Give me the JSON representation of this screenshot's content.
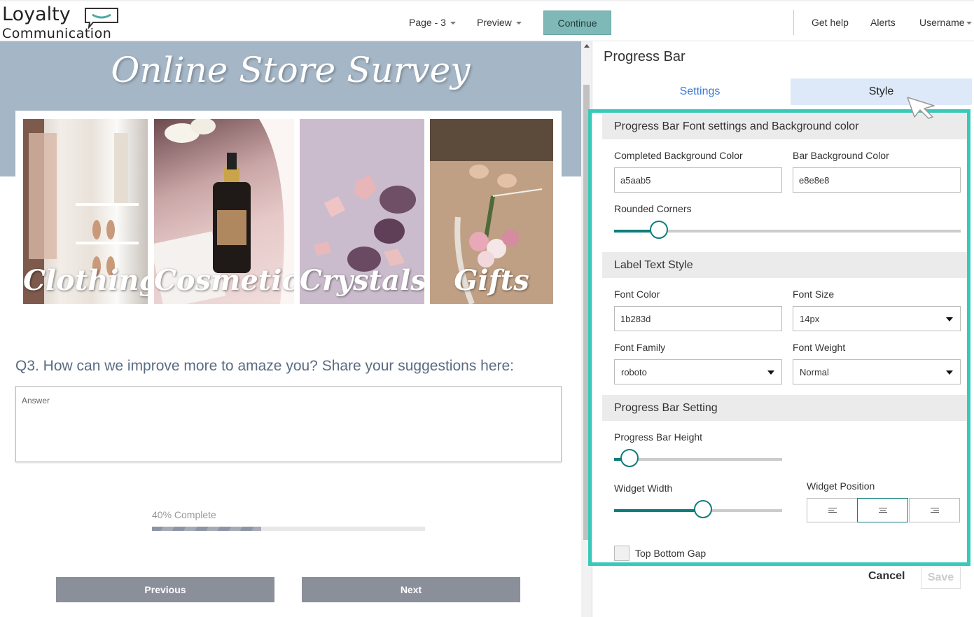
{
  "header": {
    "logo_line1": "Loyalty",
    "logo_line2": "Communication",
    "page_menu": "Page - 3",
    "preview_menu": "Preview",
    "continue_label": "Continue",
    "help_label": "Get help",
    "alerts_label": "Alerts",
    "user_label": "Username"
  },
  "survey": {
    "title": "Online Store Survey",
    "images": [
      {
        "label": "Clothing",
        "icon": "clothing-photo"
      },
      {
        "label": "Cosmetics",
        "icon": "cosmetics-photo"
      },
      {
        "label": "Crystals",
        "icon": "crystals-photo"
      },
      {
        "label": "Gifts",
        "icon": "gifts-photo"
      }
    ],
    "question": "Q3. How can we improve more to amaze you? Share your suggestions here:",
    "answer_placeholder": "Answer",
    "progress_label": "40% Complete",
    "progress_fraction": 0.4,
    "prev_label": "Previous",
    "next_label": "Next"
  },
  "panel": {
    "title": "Progress Bar",
    "tabs": [
      {
        "label": "Settings",
        "active": false
      },
      {
        "label": "Style",
        "active": true
      }
    ],
    "section_font": "Progress Bar Font settings and Background color",
    "completed_bg_label": "Completed Background Color",
    "completed_bg_value": "a5aab5",
    "bar_bg_label": "Bar Background Color",
    "bar_bg_value": "e8e8e8",
    "rounded_corners_label": "Rounded Corners",
    "rounded_corners_level": 0.13,
    "section_label_text": "Label Text Style",
    "font_color_label": "Font Color",
    "font_color_value": "1b283d",
    "font_size_label": "Font Size",
    "font_size_value": "14px",
    "font_family_label": "Font Family",
    "font_family_value": "roboto",
    "font_weight_label": "Font Weight",
    "font_weight_value": "Normal",
    "section_bar_setting": "Progress Bar Setting",
    "bar_height_label": "Progress Bar Height",
    "bar_height_level": 0.09,
    "widget_width_label": "Widget Width",
    "widget_width_level": 0.53,
    "widget_position_label": "Widget Position",
    "widget_position_selected": "center",
    "top_bottom_gap_label": "Top Bottom Gap",
    "top_bottom_gap_checked": false,
    "cancel_label": "Cancel",
    "save_label": "Save"
  },
  "colors": {
    "accent": "#107c7c",
    "highlight": "#38c9b9",
    "continue_bg": "#7fb9b7",
    "banner": "#a5b6c6",
    "tab_active_bg": "#dde9f8",
    "tab_link": "#3a7bd5"
  }
}
